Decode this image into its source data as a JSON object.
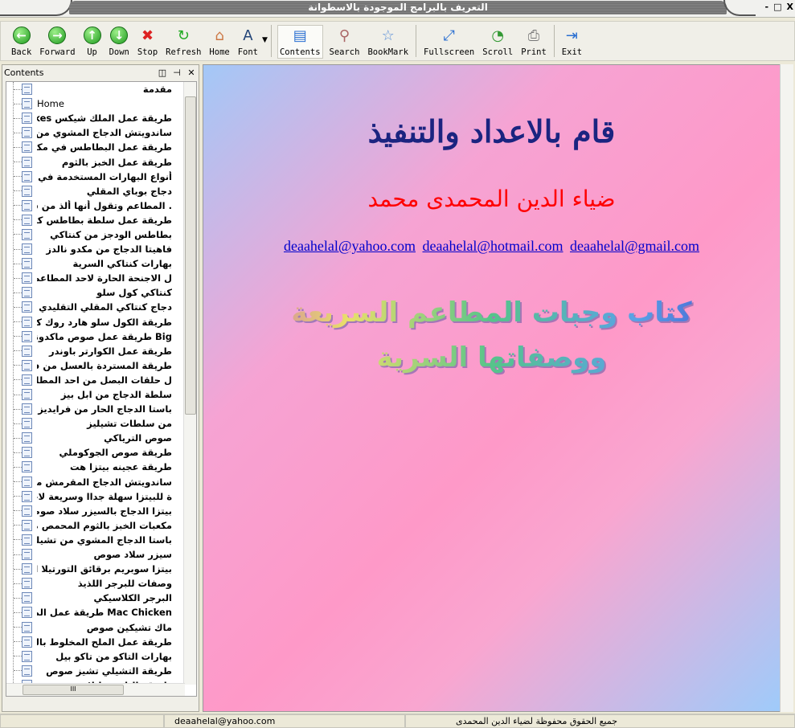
{
  "window": {
    "title": "التعريف بالبرامج الموجودة بالاسطوانة",
    "controls": [
      "-",
      "□",
      "X"
    ]
  },
  "toolbar": {
    "buttons": [
      {
        "label": "Back",
        "icon": "arrow-left-icon"
      },
      {
        "label": "Forward",
        "icon": "arrow-right-icon"
      },
      {
        "label": "Up",
        "icon": "arrow-up-icon"
      },
      {
        "label": "Down",
        "icon": "arrow-down-icon"
      },
      {
        "label": "Stop",
        "icon": "stop-icon"
      },
      {
        "label": "Refresh",
        "icon": "refresh-icon"
      },
      {
        "label": "Home",
        "icon": "home-icon"
      },
      {
        "label": "Font",
        "icon": "font-icon"
      },
      {
        "label": "Contents",
        "icon": "contents-icon",
        "active": true
      },
      {
        "label": "Search",
        "icon": "search-icon"
      },
      {
        "label": "BookMark",
        "icon": "bookmark-icon"
      },
      {
        "label": "Fullscreen",
        "icon": "fullscreen-icon"
      },
      {
        "label": "Scroll",
        "icon": "scroll-icon"
      },
      {
        "label": "Print",
        "icon": "print-icon"
      },
      {
        "label": "Exit",
        "icon": "exit-icon"
      }
    ]
  },
  "contents_pane": {
    "title": "Contents",
    "items": [
      "مقدمة",
      "Home",
      "طريقة عمل الملك شيكس Milkshakes",
      "ساندويتش الدجاج المشوي من مكدونلدز",
      "طريقة عمل البطاطس في مكدونلدز",
      "طريقة عمل الخبز بالثوم",
      "أنواع البهارات المستخدمة في قلي الدجاج",
      "دجاج بوباي المقلي",
      ". المطاعم وتقول أنها ألذ من سلطة كنتاكي",
      "طريقة عمل سلطة بطاطس كنتاكي",
      "بطاطس الودجز من كنتاكي",
      "فاهيتا الدجاج من مكدو نالدز",
      "بهارات كنتاكي السرية",
      "ل الاجنحة الحارة لاحد المطاعم المشهورة",
      "كنتاكي كول سلو",
      "دجاج كنتاكي المقلي التقليدي",
      "طريقة الكول سلو هارد روك كافيه",
      "Big طريقة عمل صوص ماكدونلدز بج ماك",
      "طريقة عمل الكوارتر باوندر",
      "طريقة المستردة بالعسل من فد ركرز",
      "ل حلقات البصل من احد المطاعم المشهورة",
      "سلطة الدجاج من ابل بيز",
      "باستا الدجاج الحار من فرايديز",
      "من سلطات تشيليز",
      "صوص الترياكي",
      "طريقة صوص الجوكوملي",
      "طريقة عجينه بيتزا هت",
      "ساندويتش الدجاج المقرمش مع الجبن",
      "ة للبيتزا سهلة جداا وسريعة لاحد المطاعم",
      "بيتزا الدجاج بالسيزر سلاد صوص",
      "مكعبات الخبز بالثوم المحمص من بيتزاهت",
      "باستا الدجاج المشوي من تشيليز",
      "سيزر سلاد صوص",
      "بيتزا سوبريم برقائق التورتيلا المكسيكية",
      "وصفات للبرجر اللذيذ",
      "البرجر الكلاسيكي",
      "Mac Chicken طريقة عمل الماك تشيكن",
      "ماك تشيكين صوص",
      "طريقة عمل الملح المخلوط بالبهارات",
      "بهارات التاكو من تاكو بيل",
      "طريقة التشيلي تشيز صوص",
      "طريقة الثاوزند ايلاند"
    ]
  },
  "main": {
    "heading": "قام بالاعداد والتنفيذ",
    "author": "ضياء الدين المحمدى محمد",
    "emails": [
      "deaahelal@yahoo.com",
      "deaahelal@hotmail.com",
      "deaahelal@gmail.com"
    ],
    "wordart_lines": [
      "كتاب وجبات المطاعم السريعة",
      "ووصفاتها السرية"
    ],
    "colors": {
      "heading": "#1b2480",
      "author": "#ff0000",
      "link": "#0000cc"
    }
  },
  "status": {
    "email": "deaahelal@yahoo.com",
    "copyright": "جميع الحقوق محفوظة لضياء الدين المحمدى"
  }
}
